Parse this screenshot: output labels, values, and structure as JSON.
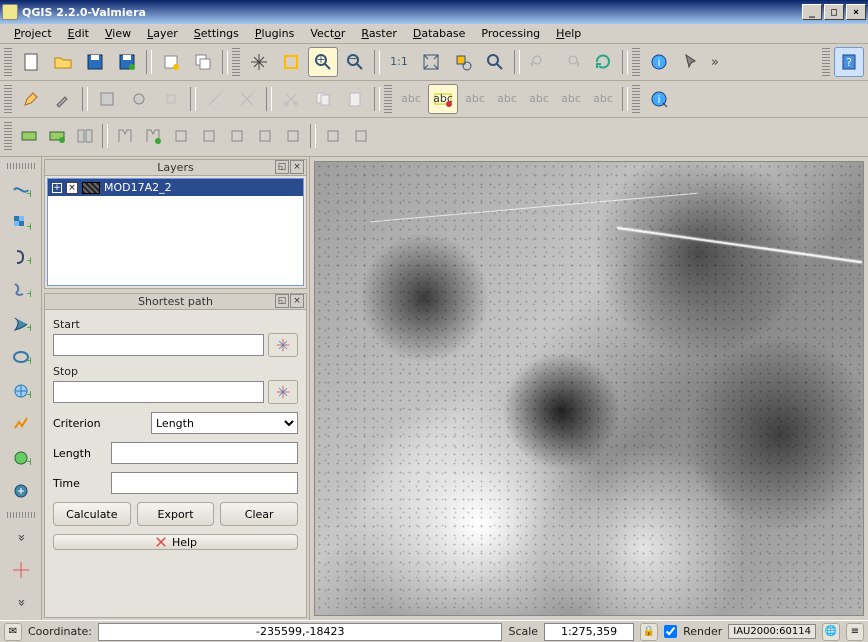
{
  "title": "QGIS 2.2.0-Valmiera",
  "menu": [
    "Project",
    "Edit",
    "View",
    "Layer",
    "Settings",
    "Plugins",
    "Vector",
    "Raster",
    "Database",
    "Processing",
    "Help"
  ],
  "panels": {
    "layers": {
      "title": "Layers",
      "layer_name": "MOD17A2_2"
    },
    "shortest_path": {
      "title": "Shortest path",
      "start_label": "Start",
      "stop_label": "Stop",
      "criterion_label": "Criterion",
      "criterion_value": "Length",
      "length_label": "Length",
      "time_label": "Time",
      "calculate": "Calculate",
      "export": "Export",
      "clear": "Clear",
      "help": "Help"
    }
  },
  "status": {
    "coord_label": "Coordinate:",
    "coord_value": "-235599,-18423",
    "scale_label": "Scale",
    "scale_value": "1:275,359",
    "render_label": "Render",
    "render_checked": true,
    "crs": "IAU2000:60114"
  }
}
